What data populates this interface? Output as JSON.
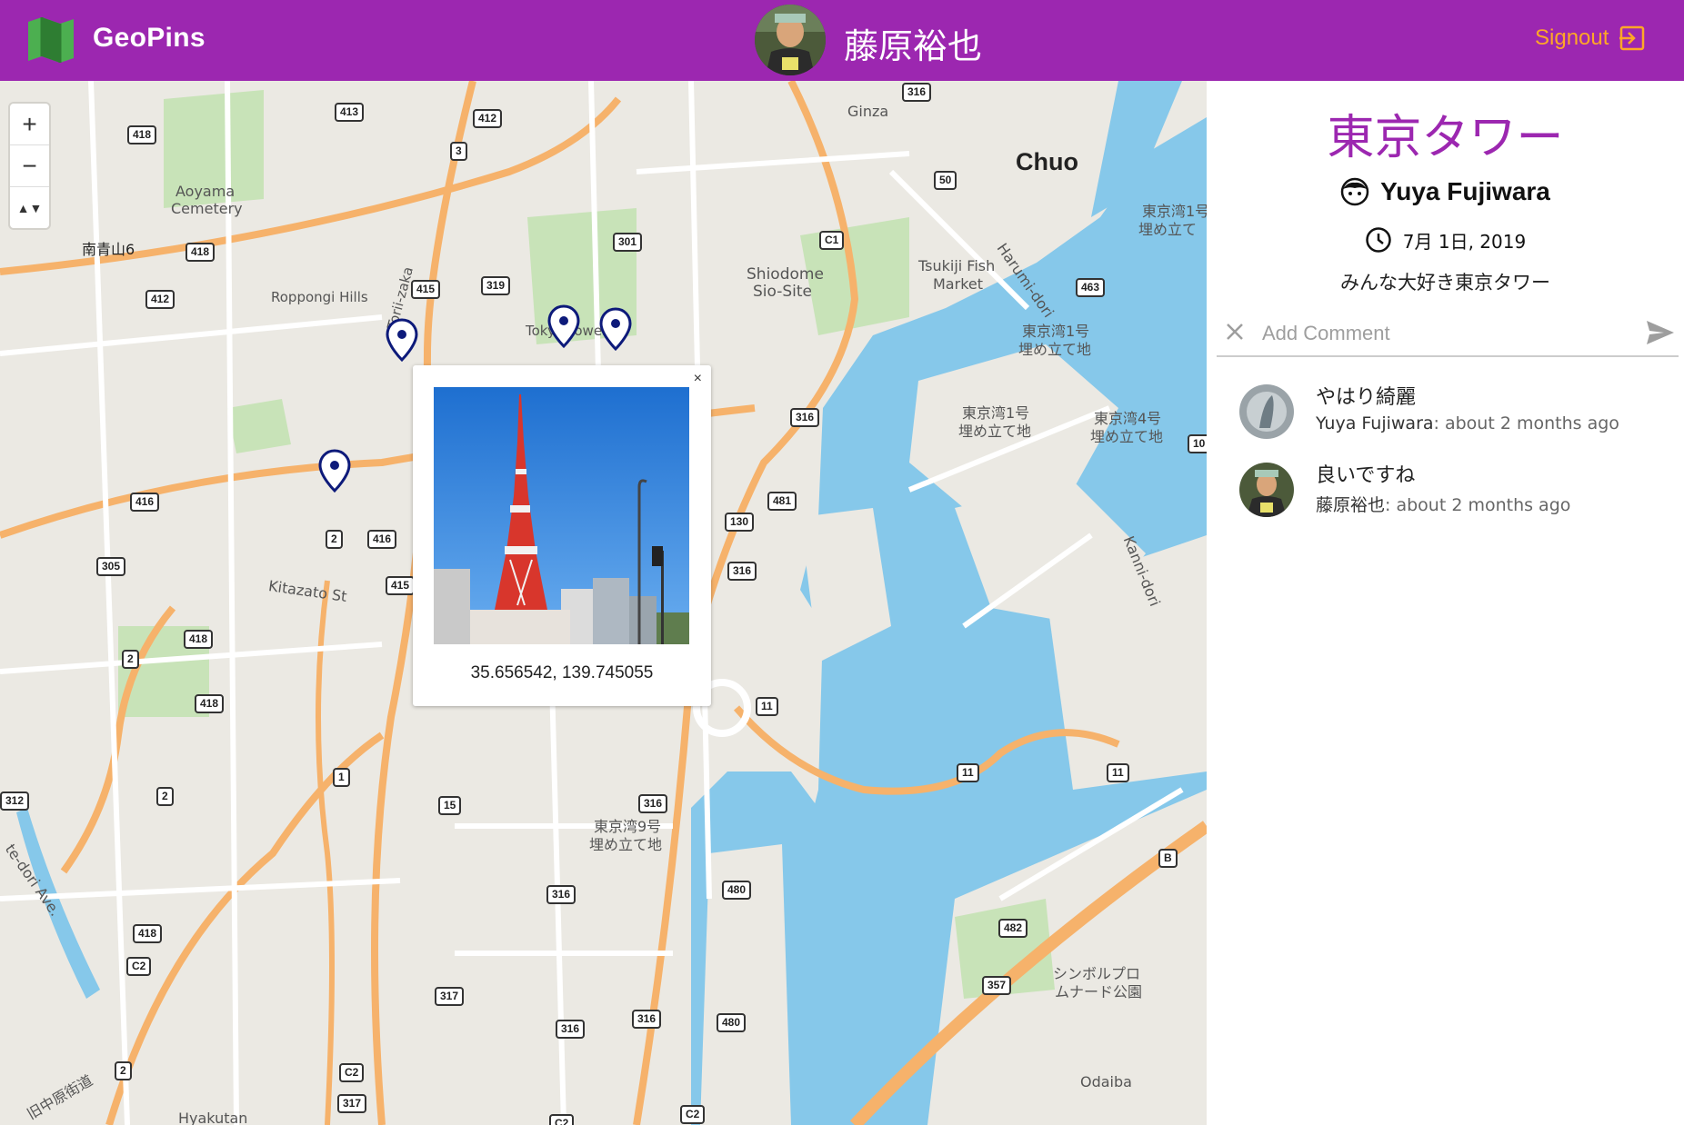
{
  "app": {
    "title": "GeoPins",
    "user_name": "藤原裕也",
    "signout_label": "Signout",
    "brand_color": "#9c27b0",
    "accent_color": "#ffa726"
  },
  "map": {
    "zoom_in": "+",
    "zoom_out": "−",
    "compass": "▲▼",
    "labels": {
      "ginza": "Ginza",
      "chuo": "Chuo",
      "harumi": "Harumi-dori",
      "tsukiji": "Tsukiji Fish",
      "tsukiji2": "Market",
      "shiodome": "Shiodome",
      "siosite": "Sio-Site",
      "aoyama": "Aoyama",
      "cemetery": "Cemetery",
      "minamiaoyama": "南青山6",
      "roppongi": "Roppongi Hills",
      "torii": "Torii-zaka",
      "tokyotower": "Tokyo Tower",
      "kitazato": "Kitazato St",
      "reclaim1": "東京湾1号",
      "reclaim1b": "埋め立て地",
      "reclaim1c": "東京湾1号",
      "reclaim1d": "埋め立て地",
      "reclaim4": "東京湾4号",
      "reclaim4b": "埋め立て地",
      "reclaim1e": "東京湾1号",
      "reclaim1f": "埋め立て",
      "kanni": "Kanni-dori",
      "reclaim9": "東京湾9号",
      "reclaim9b": "埋め立て地",
      "symbol": "シンボルプロ",
      "symbol2": "ムナード公園",
      "odaiba": "Odaiba",
      "kyunaka": "旧中原街道",
      "dori": "te-dori Ave.",
      "hyakutan": "Hyakutan"
    },
    "shields": [
      "413",
      "412",
      "418",
      "3",
      "418",
      "412",
      "415",
      "319",
      "301",
      "316",
      "50",
      "C1",
      "463",
      "316",
      "481",
      "130",
      "316",
      "416",
      "2",
      "416",
      "415",
      "305",
      "418",
      "2",
      "418",
      "1",
      "2",
      "312",
      "15",
      "316",
      "316",
      "480",
      "11",
      "11",
      "11",
      "B",
      "482",
      "357",
      "418",
      "C2",
      "317",
      "316",
      "316",
      "480",
      "2",
      "C2",
      "317",
      "C2",
      "C2",
      "10"
    ]
  },
  "popup": {
    "close": "×",
    "coords": "35.656542, 139.745055"
  },
  "pin": {
    "title": "東京タワー",
    "author": "Yuya Fujiwara",
    "date": "7月 1日, 2019",
    "description": "みんな大好き東京タワー"
  },
  "comments_ui": {
    "placeholder": "Add Comment"
  },
  "comments": [
    {
      "text": "やはり綺麗",
      "author": "Yuya Fujiwara",
      "time": ": about 2 months ago"
    },
    {
      "text": "良いですね",
      "author": "藤原裕也",
      "time": ": about 2 months ago"
    }
  ]
}
